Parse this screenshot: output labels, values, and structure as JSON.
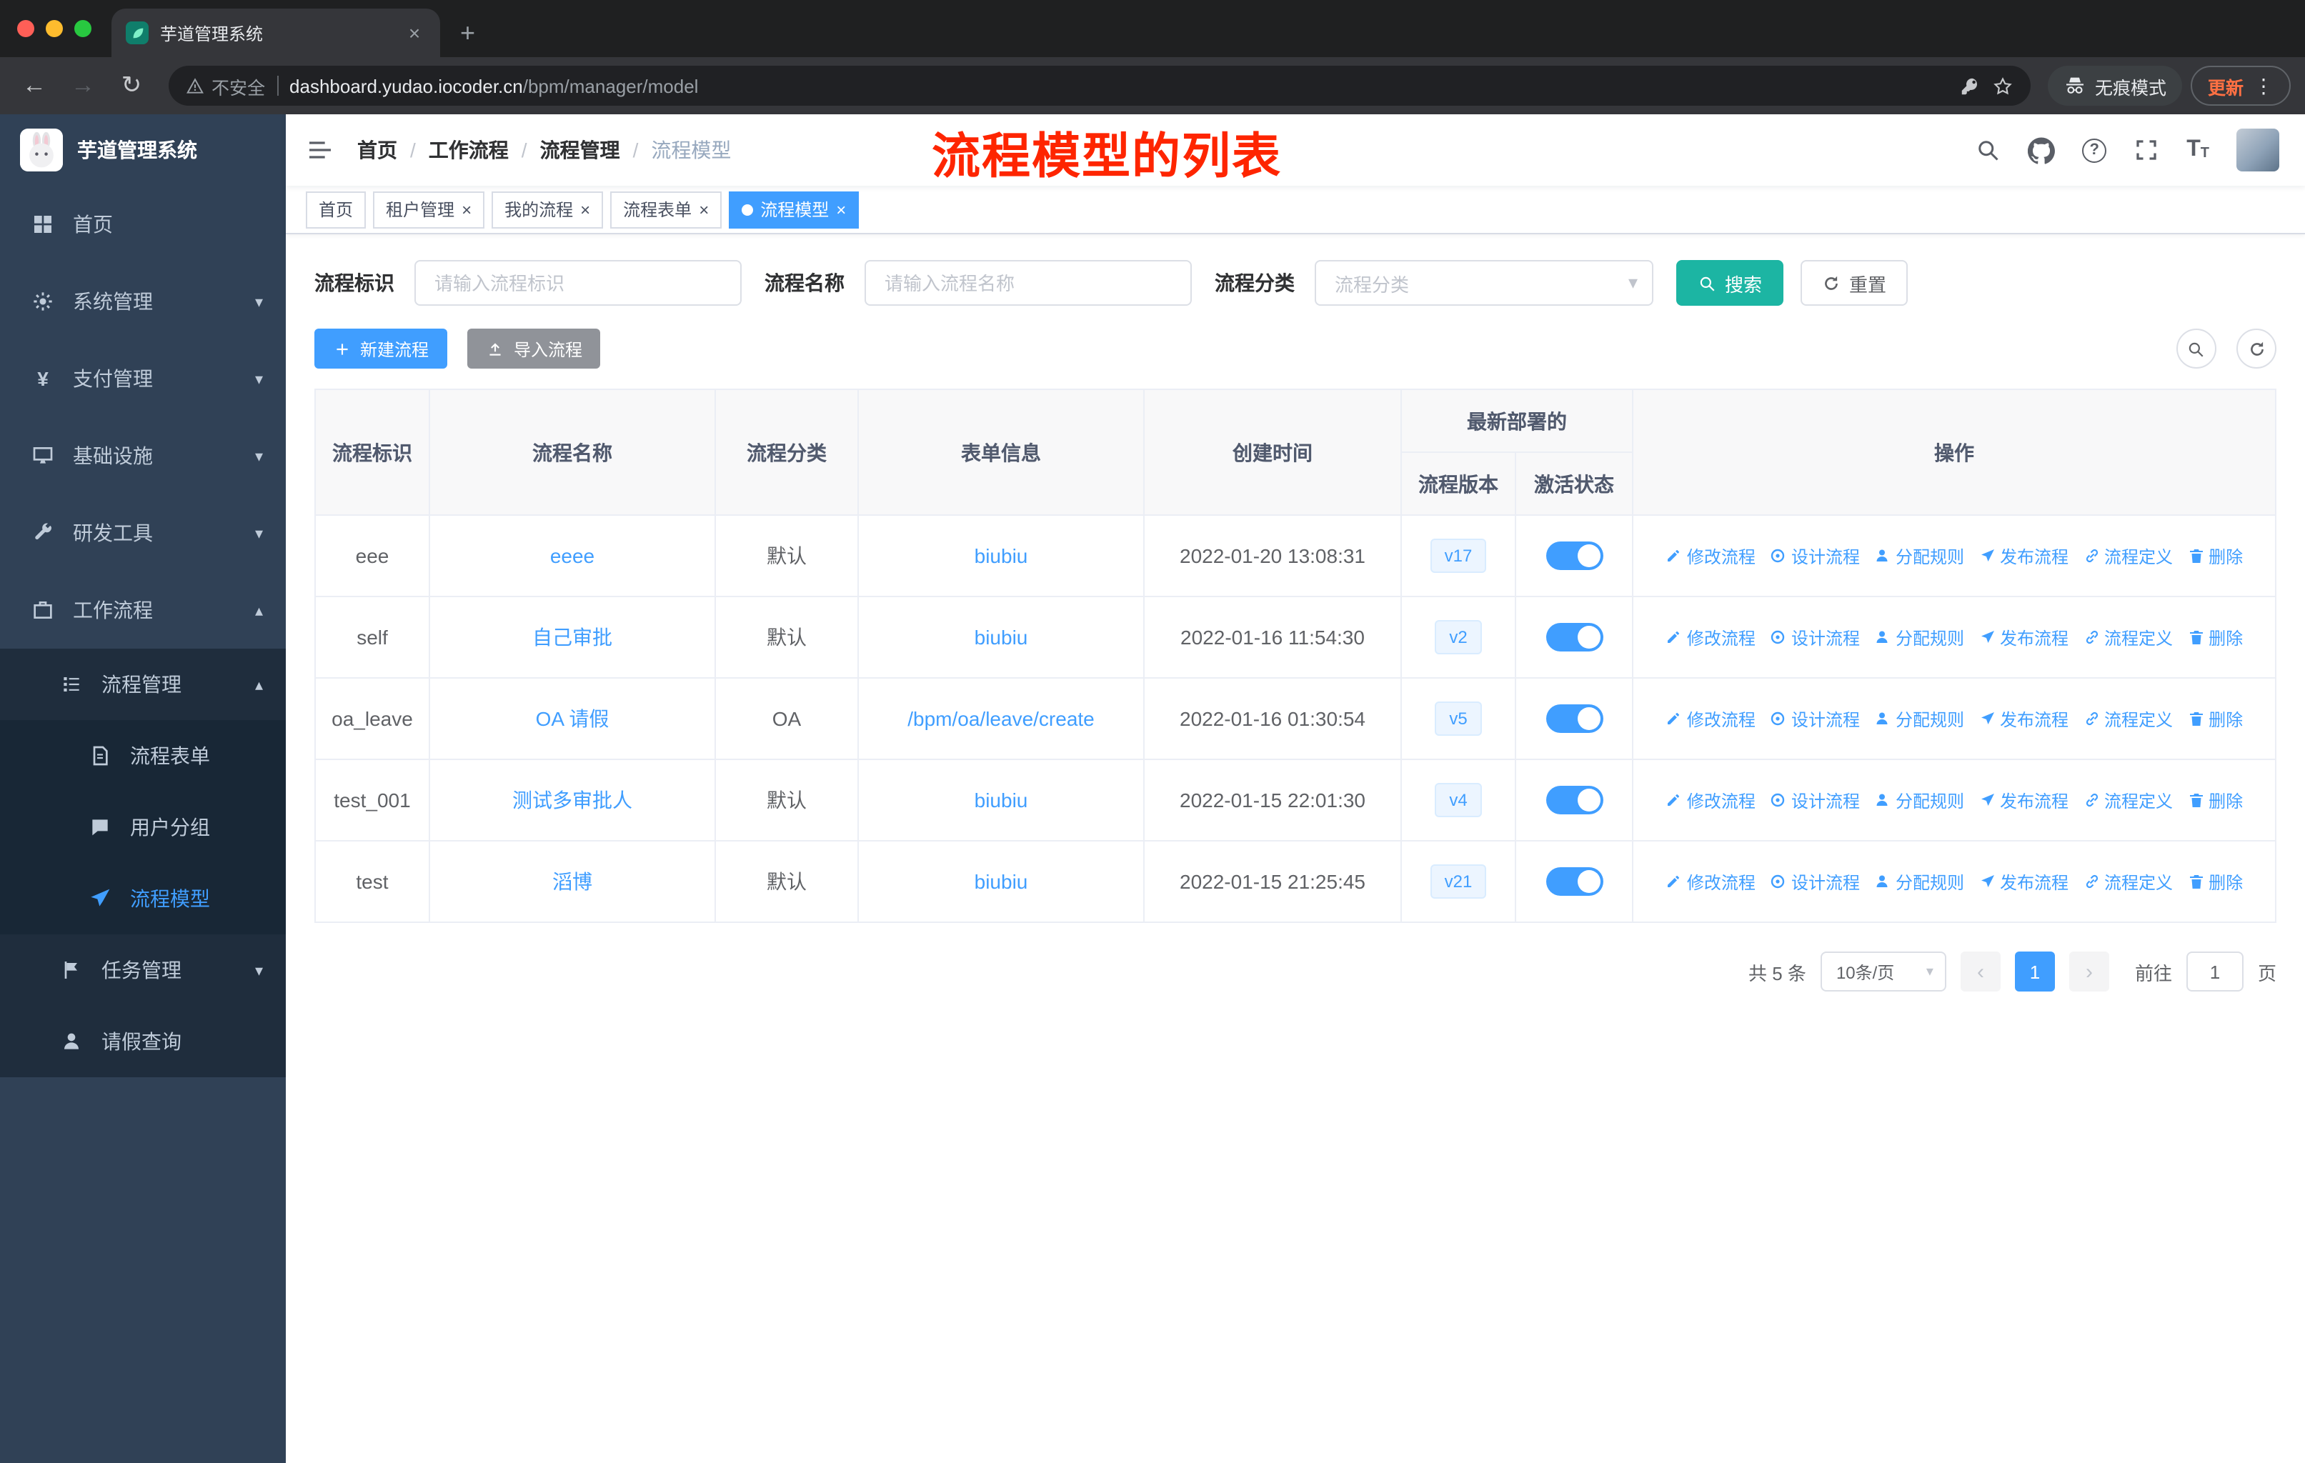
{
  "browser": {
    "tab_title": "芋道管理系统",
    "security": "不安全",
    "host": "dashboard.yudao.iocoder.cn",
    "path": "/bpm/manager/model",
    "incognito": "无痕模式",
    "update": "更新"
  },
  "annotation": {
    "text": "流程模型的列表"
  },
  "sidebar": {
    "title": "芋道管理系统",
    "items": [
      {
        "label": "首页"
      },
      {
        "label": "系统管理"
      },
      {
        "label": "支付管理"
      },
      {
        "label": "基础设施"
      },
      {
        "label": "研发工具"
      },
      {
        "label": "工作流程"
      },
      {
        "label": "流程管理"
      },
      {
        "label": "流程表单"
      },
      {
        "label": "用户分组"
      },
      {
        "label": "流程模型"
      },
      {
        "label": "任务管理"
      },
      {
        "label": "请假查询"
      }
    ]
  },
  "navbar": {
    "breadcrumb": [
      "首页",
      "工作流程",
      "流程管理",
      "流程模型"
    ]
  },
  "tags": [
    {
      "label": "首页"
    },
    {
      "label": "租户管理"
    },
    {
      "label": "我的流程"
    },
    {
      "label": "流程表单"
    },
    {
      "label": "流程模型"
    }
  ],
  "filters": {
    "key_label": "流程标识",
    "key_placeholder": "请输入流程标识",
    "name_label": "流程名称",
    "name_placeholder": "请输入流程名称",
    "category_label": "流程分类",
    "category_placeholder": "流程分类",
    "search_label": "搜索",
    "reset_label": "重置"
  },
  "toolbar": {
    "create_label": "新建流程",
    "import_label": "导入流程"
  },
  "table": {
    "headers": {
      "id": "流程标识",
      "name": "流程名称",
      "category": "流程分类",
      "form": "表单信息",
      "created": "创建时间",
      "deploy_group": "最新部署的",
      "version": "流程版本",
      "active": "激活状态",
      "actions": "操作"
    },
    "action_labels": [
      "修改流程",
      "设计流程",
      "分配规则",
      "发布流程",
      "流程定义",
      "删除"
    ],
    "rows": [
      {
        "id": "eee",
        "name": "eeee",
        "category": "默认",
        "form": "biubiu",
        "created": "2022-01-20 13:08:31",
        "version": "v17",
        "active": true
      },
      {
        "id": "self",
        "name": "自己审批",
        "category": "默认",
        "form": "biubiu",
        "created": "2022-01-16 11:54:30",
        "version": "v2",
        "active": true
      },
      {
        "id": "oa_leave",
        "name": "OA 请假",
        "category": "OA",
        "form": "/bpm/oa/leave/create",
        "created": "2022-01-16 01:30:54",
        "version": "v5",
        "active": true
      },
      {
        "id": "test_001",
        "name": "测试多审批人",
        "category": "默认",
        "form": "biubiu",
        "created": "2022-01-15 22:01:30",
        "version": "v4",
        "active": true
      },
      {
        "id": "test",
        "name": "滔博",
        "category": "默认",
        "form": "biubiu",
        "created": "2022-01-15 21:25:45",
        "version": "v21",
        "active": true
      }
    ]
  },
  "pagination": {
    "total": "共 5 条",
    "page_size": "10条/页",
    "current_page": "1",
    "goto_label": "前往",
    "goto_value": "1",
    "page_unit": "页"
  },
  "icons": {
    "close": "×",
    "plus": "+",
    "overflow": "⋮",
    "back": "←",
    "forward": "→",
    "reload": "↻",
    "chevron_down": "▾",
    "chevron_up": "▴",
    "help": "?",
    "yen": "¥",
    "prev": "‹",
    "next": "›",
    "separator": "/",
    "font_size": "T"
  },
  "colors": {
    "accent": "#409eff",
    "search_button": "#1cb5a3",
    "annotation": "#fe2500",
    "sidebar_bg": "#304156",
    "sidebar_sub_bg": "#1f2d3d",
    "sidebar_sub2_bg": "#182736",
    "info_button": "#909399",
    "tag_active": "#409eff",
    "update_badge": "#ff7043"
  }
}
